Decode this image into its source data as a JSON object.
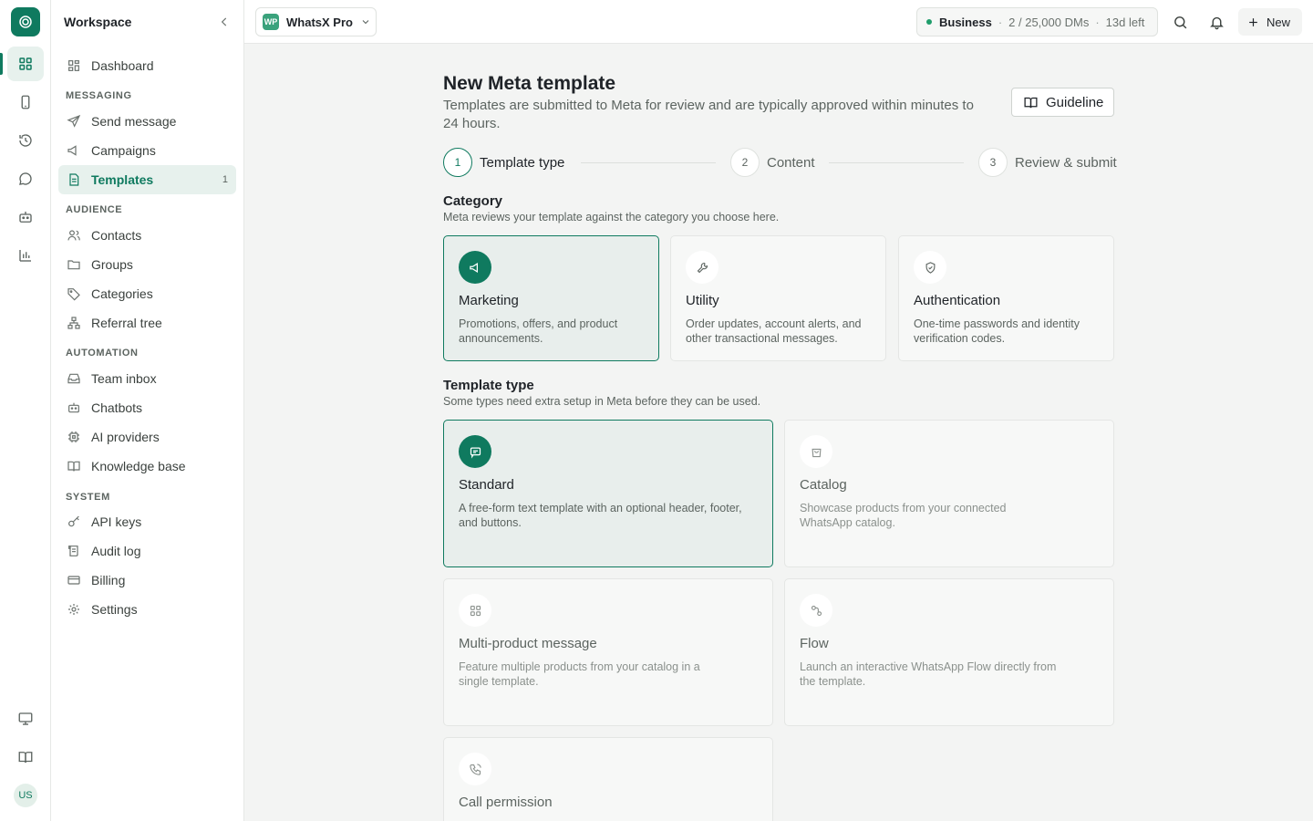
{
  "rail": {
    "logo_icon": "whatsapp-logo-icon",
    "items": [
      "grid-icon",
      "phone-icon",
      "history-icon",
      "chat-icon",
      "bot-icon",
      "chart-icon"
    ],
    "bottom": [
      "monitor-icon",
      "book-icon"
    ],
    "avatar": "US"
  },
  "sidebar": {
    "title": "Workspace",
    "dashboard": "Dashboard",
    "sections": {
      "messaging": "MESSAGING",
      "audience": "AUDIENCE",
      "automation": "AUTOMATION",
      "system": "SYSTEM"
    },
    "items": {
      "send_message": "Send message",
      "campaigns": "Campaigns",
      "templates": "Templates",
      "templates_count": "1",
      "contacts": "Contacts",
      "groups": "Groups",
      "categories": "Categories",
      "referral_tree": "Referral tree",
      "team_inbox": "Team inbox",
      "chatbots": "Chatbots",
      "ai_providers": "AI providers",
      "knowledge_base": "Knowledge base",
      "api_keys": "API keys",
      "audit_log": "Audit log",
      "billing": "Billing",
      "settings": "Settings"
    }
  },
  "topbar": {
    "project_badge": "WP",
    "project_name": "WhatsX Pro",
    "plan_name": "Business",
    "plan_usage": "2 / 25,000 DMs",
    "plan_remaining": "13d left",
    "new_label": "New",
    "sep": "·"
  },
  "page": {
    "title": "New Meta template",
    "subtitle": "Templates are submitted to Meta for review and are typically approved within minutes to 24 hours.",
    "guideline": "Guideline",
    "steps": [
      {
        "num": "1",
        "label": "Template type"
      },
      {
        "num": "2",
        "label": "Content"
      },
      {
        "num": "3",
        "label": "Review & submit"
      }
    ],
    "category": {
      "title": "Category",
      "subtitle": "Meta reviews your template against the category you choose here.",
      "cards": [
        {
          "title": "Marketing",
          "desc": "Promotions, offers, and product announcements.",
          "icon": "megaphone-icon"
        },
        {
          "title": "Utility",
          "desc": "Order updates, account alerts, and other transactional messages.",
          "icon": "wrench-icon"
        },
        {
          "title": "Authentication",
          "desc": "One-time passwords and identity verification codes.",
          "icon": "shield-icon"
        }
      ]
    },
    "template_type": {
      "title": "Template type",
      "subtitle": "Some types need extra setup in Meta before they can be used.",
      "cards": [
        {
          "title": "Standard",
          "desc": "A free-form text template with an optional header, footer, and buttons.",
          "icon": "message-icon"
        },
        {
          "title": "Catalog",
          "desc": "Showcase products from your connected WhatsApp catalog.",
          "icon": "bag-icon"
        },
        {
          "title": "Multi-product message",
          "desc": "Feature multiple products from your catalog in a single template.",
          "icon": "grid-icon"
        },
        {
          "title": "Flow",
          "desc": "Launch an interactive WhatsApp Flow directly from the template.",
          "icon": "flow-icon"
        },
        {
          "title": "Call permission",
          "desc": "",
          "icon": "phone-call-icon"
        }
      ]
    }
  }
}
